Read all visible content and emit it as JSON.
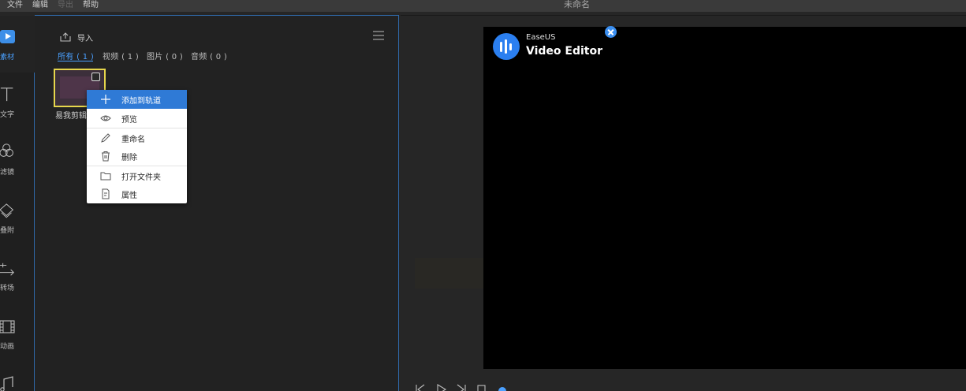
{
  "menu": {
    "items": [
      "文件",
      "编辑",
      "导出",
      "帮助"
    ],
    "disabled_index": 2
  },
  "window": {
    "title": "未命名"
  },
  "rail": {
    "items": [
      {
        "label": "素材",
        "icon": "media-play-icon",
        "active": true
      },
      {
        "label": "文字",
        "icon": "text-T-icon"
      },
      {
        "label": "滤镜",
        "icon": "filter-circles-icon"
      },
      {
        "label": "叠附",
        "icon": "overlay-layers-icon"
      },
      {
        "label": "转场",
        "icon": "transition-arrows-icon"
      },
      {
        "label": "动画",
        "icon": "animation-film-icon"
      },
      {
        "label": "",
        "icon": "music-note-icon"
      }
    ]
  },
  "media": {
    "import_label": "导入",
    "filters": [
      {
        "label": "所有 ( 1 )",
        "active": true
      },
      {
        "label": "视频 ( 1 )"
      },
      {
        "label": "图片 ( 0 )"
      },
      {
        "label": "音频 ( 0 )"
      }
    ],
    "item_name": "易我剪辑"
  },
  "context_menu": {
    "items": [
      {
        "label": "添加到轨道",
        "icon": "plus-icon",
        "highlighted": true
      },
      {
        "label": "预览",
        "icon": "eye-icon"
      },
      {
        "label": "重命名",
        "icon": "pencil-icon"
      },
      {
        "label": "删除",
        "icon": "trash-icon"
      },
      {
        "label": "打开文件夹",
        "icon": "folder-icon"
      },
      {
        "label": "属性",
        "icon": "properties-doc-icon"
      }
    ]
  },
  "preview": {
    "brand_small": "EaseUS",
    "brand_big": "Video Editor"
  },
  "colors": {
    "accent": "#3d8fe8",
    "highlight": "#2f7ad6",
    "selection_border": "#e6d64c"
  }
}
